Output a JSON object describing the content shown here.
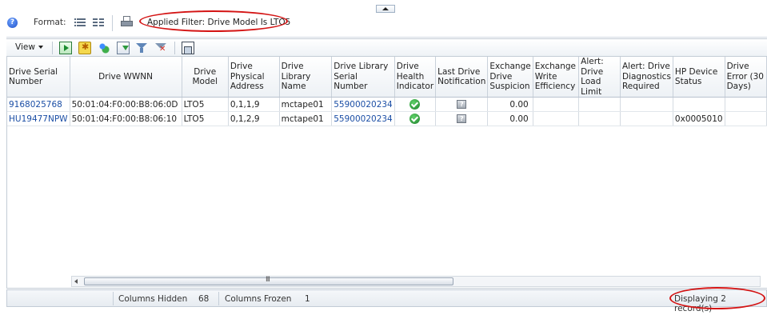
{
  "format_bar": {
    "help_icon": "?",
    "format_label": "Format:",
    "format_list_icon": "list-view-icon",
    "format_detail_icon": "detail-view-icon",
    "print_icon": "printer-icon",
    "applied_filter": "Applied Filter: Drive Model Is LTO5"
  },
  "toolbar": {
    "view_label": "View",
    "icons": [
      "run-report-icon",
      "new-report-icon",
      "manage-icon",
      "export-icon",
      "filter-icon",
      "clear-filter-icon",
      "detach-icon"
    ]
  },
  "table": {
    "columns": [
      {
        "label": "Drive Serial Number"
      },
      {
        "label": "Drive WWNN"
      },
      {
        "label": "Drive Model"
      },
      {
        "label": "Drive Physical Address"
      },
      {
        "label": "Drive Library Name"
      },
      {
        "label": "Drive Library Serial Number"
      },
      {
        "label": "Drive Health Indicator"
      },
      {
        "label": "Last Drive Notification"
      },
      {
        "label": "Exchange Drive Suspicion"
      },
      {
        "label": "Exchange Write Efficiency"
      },
      {
        "label": "Alert: Drive Load Limit"
      },
      {
        "label": "Alert: Drive Diagnostics Required"
      },
      {
        "label": "HP Device Status"
      },
      {
        "label": "Drive Error (30 Days)"
      }
    ],
    "rows": [
      {
        "serial": "9168025768",
        "wwnn": "50:01:04:F0:00:B8:06:0D",
        "model": "LTO5",
        "physical_address": "0,1,1,9",
        "library_name": "mctape01",
        "library_serial": "55900020234",
        "health": "ok",
        "notification": "unknown",
        "suspicion": "0.00",
        "write_efficiency": "",
        "load_limit": "",
        "diagnostics": "",
        "hp_status": "",
        "error_30": ""
      },
      {
        "serial": "HU19477NPW",
        "wwnn": "50:01:04:F0:00:B8:06:10",
        "model": "LTO5",
        "physical_address": "0,1,2,9",
        "library_name": "mctape01",
        "library_serial": "55900020234",
        "health": "ok",
        "notification": "unknown",
        "suspicion": "0.00",
        "write_efficiency": "",
        "load_limit": "",
        "diagnostics": "",
        "hp_status": "0x0005010",
        "error_30": ""
      }
    ]
  },
  "scrollbar": {
    "grip": "III"
  },
  "status": {
    "columns_hidden_label": "Columns Hidden",
    "columns_hidden_value": "68",
    "columns_frozen_label": "Columns Frozen",
    "columns_frozen_value": "1",
    "records": "Displaying 2 record(s)"
  },
  "colors": {
    "annotation_red": "#d41414",
    "link_blue": "#1b4ea5"
  }
}
